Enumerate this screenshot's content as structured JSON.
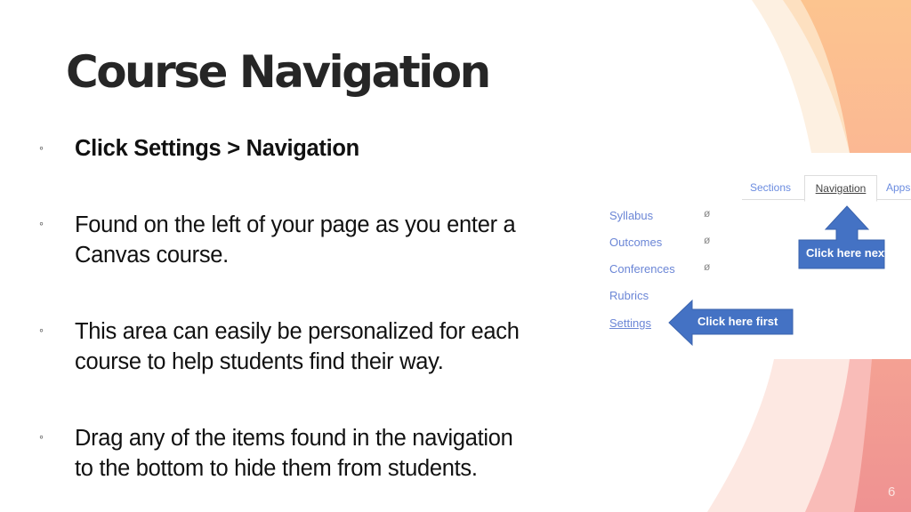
{
  "slide": {
    "title": "Course Navigation",
    "page_number": "6",
    "bullets": [
      {
        "symbol": "◦",
        "lines": [
          "Click Settings > Navigation"
        ],
        "bold": true
      },
      {
        "symbol": "◦",
        "lines": [
          "Found on the left of your page as you enter a",
          "Canvas course."
        ],
        "bold": false
      },
      {
        "symbol": "◦",
        "lines": [
          "This area can easily be personalized for each",
          "course to help students find their way."
        ],
        "bold": false
      },
      {
        "symbol": "◦",
        "lines": [
          "Drag any of the items found in the navigation",
          "to the bottom to hide them from students."
        ],
        "bold": false
      }
    ]
  },
  "screenshot": {
    "tabs": [
      {
        "label": "Sections",
        "active": false
      },
      {
        "label": "Navigation",
        "active": true
      },
      {
        "label": "Apps",
        "active": false
      }
    ],
    "nav_items": [
      {
        "label": "Syllabus",
        "hidden_icon": "eye-slash-icon"
      },
      {
        "label": "Outcomes",
        "hidden_icon": "eye-slash-icon"
      },
      {
        "label": "Conferences",
        "hidden_icon": "eye-slash-icon"
      },
      {
        "label": "Rubrics",
        "hidden_icon": null
      },
      {
        "label": "Settings",
        "hidden_icon": null
      }
    ],
    "eye_glyph": "ø",
    "callouts": {
      "first": "Click here first",
      "next": "Click here next!"
    }
  },
  "colors": {
    "arrow_blue": "#4472c4",
    "link_blue": "#6b86d6",
    "title": "#262626"
  }
}
